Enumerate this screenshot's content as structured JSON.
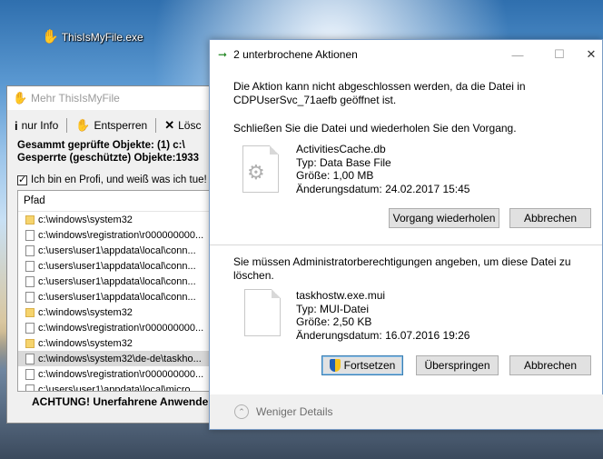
{
  "desktop": {
    "icon_label": "ThisIsMyFile.exe",
    "icon": "hand-icon"
  },
  "back_window": {
    "title": "Mehr ThisIsMyFile",
    "toolbar": {
      "info_label": "nur Info",
      "unlock_label": "Entsperren",
      "delete_label": "Lösc"
    },
    "checked_line": "Gesammt geprüfte Objekte: (1) c:\\",
    "locked_line": "Gesperrte (geschützte) Objekte:1933",
    "profi_checkbox": "Ich bin en Profi, und weiß was ich tue!",
    "list_header": "Pfad",
    "rows": [
      {
        "type": "folder",
        "text": "c:\\windows\\system32"
      },
      {
        "type": "file",
        "text": "c:\\windows\\registration\\r000000000..."
      },
      {
        "type": "file",
        "text": "c:\\users\\user1\\appdata\\local\\conn..."
      },
      {
        "type": "file",
        "text": "c:\\users\\user1\\appdata\\local\\conn..."
      },
      {
        "type": "file",
        "text": "c:\\users\\user1\\appdata\\local\\conn..."
      },
      {
        "type": "file",
        "text": "c:\\users\\user1\\appdata\\local\\conn..."
      },
      {
        "type": "folder",
        "text": "c:\\windows\\system32"
      },
      {
        "type": "file",
        "text": "c:\\windows\\registration\\r000000000..."
      },
      {
        "type": "folder",
        "text": "c:\\windows\\system32"
      },
      {
        "type": "file",
        "text": "c:\\windows\\system32\\de-de\\taskho...",
        "selected": true
      },
      {
        "type": "file",
        "text": "c:\\windows\\registration\\r000000000..."
      },
      {
        "type": "file",
        "text": "c:\\users\\user1\\appdata\\local\\micro..."
      }
    ],
    "warning": "ACHTUNG! Unerfahrene Anwende"
  },
  "dialog": {
    "title": "2 unterbrochene Aktionen",
    "section1": {
      "message": "Die Aktion kann nicht abgeschlossen werden, da die Datei in CDPUserSvc_71aefb geöffnet ist.",
      "hint": "Schließen Sie die Datei und wiederholen Sie den Vorgang.",
      "file_name": "ActivitiesCache.db",
      "file_type": "Typ: Data Base File",
      "file_size": "Größe: 1,00 MB",
      "file_date": "Änderungsdatum: 24.02.2017 15:45",
      "retry_button": "Vorgang wiederholen",
      "cancel_button": "Abbrechen"
    },
    "section2": {
      "message": "Sie müssen Administratorberechtigungen angeben, um diese Datei zu löschen.",
      "file_name": "taskhostw.exe.mui",
      "file_type": "Typ: MUI-Datei",
      "file_size": "Größe: 2,50 KB",
      "file_date": "Änderungsdatum: 16.07.2016 19:26",
      "continue_button": "Fortsetzen",
      "skip_button": "Überspringen",
      "cancel_button": "Abbrechen"
    },
    "fewer_details": "Weniger Details"
  }
}
